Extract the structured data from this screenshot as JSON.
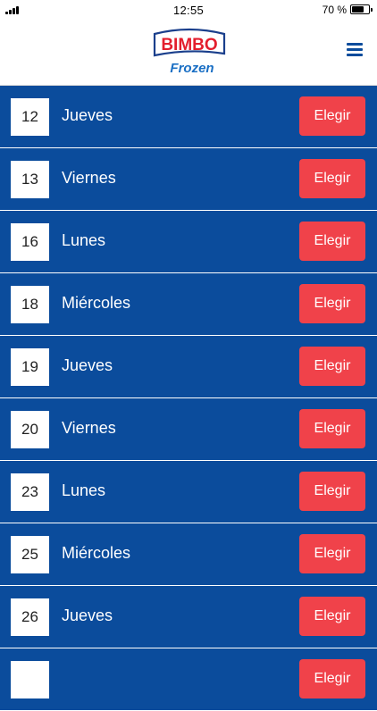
{
  "status_bar": {
    "time": "12:55",
    "battery_text": "70 %",
    "battery_level": 0.7
  },
  "header": {
    "logo_brand": "BIMBO",
    "logo_sub": "Frozen",
    "menu_icon": "hamburger-menu-icon"
  },
  "colors": {
    "background": "#0b4c9c",
    "button": "#f0424a",
    "logo_red": "#e31e2d",
    "logo_blue": "#1a6fc4"
  },
  "days": [
    {
      "number": "12",
      "name": "Jueves",
      "button": "Elegir"
    },
    {
      "number": "13",
      "name": "Viernes",
      "button": "Elegir"
    },
    {
      "number": "16",
      "name": "Lunes",
      "button": "Elegir"
    },
    {
      "number": "18",
      "name": "Miércoles",
      "button": "Elegir"
    },
    {
      "number": "19",
      "name": "Jueves",
      "button": "Elegir"
    },
    {
      "number": "20",
      "name": "Viernes",
      "button": "Elegir"
    },
    {
      "number": "23",
      "name": "Lunes",
      "button": "Elegir"
    },
    {
      "number": "25",
      "name": "Miércoles",
      "button": "Elegir"
    },
    {
      "number": "26",
      "name": "Jueves",
      "button": "Elegir"
    },
    {
      "number": "",
      "name": "",
      "button": "Elegir"
    }
  ]
}
